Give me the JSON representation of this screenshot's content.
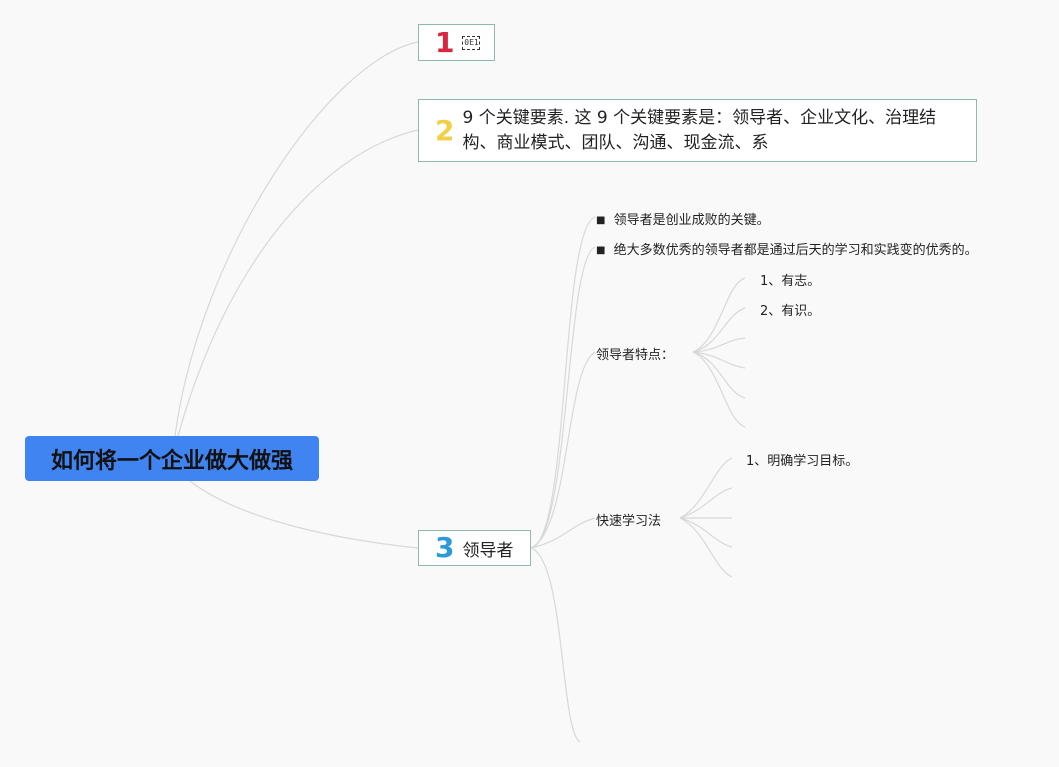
{
  "root": {
    "title": "如何将一个企业做大做强"
  },
  "topics": [
    {
      "number": "1",
      "label": ""
    },
    {
      "number": "2",
      "label": "9 个关键要素. 这 9 个关键要素是：领导者、企业文化、治理结构、商业模式、团队、沟通、现金流、系"
    },
    {
      "number": "3",
      "label": "领导者"
    }
  ],
  "leader": {
    "notes": [
      "领导者是创业成败的关键。",
      "绝大多数优秀的领导者都是通过后天的学习和实践变的优秀的。"
    ],
    "traits": {
      "label": "领导者特点：",
      "items": [
        "1、有志。",
        "2、有识。"
      ]
    },
    "fast_learning": {
      "label": "快速学习法",
      "items": [
        "1、明确学习目标。"
      ]
    }
  },
  "colors": {
    "root_bg": "#3f84f0",
    "topic_border": "#8fb8ae",
    "badge1": "#d7263d",
    "badge2": "#f2cf45",
    "badge3": "#2b9ad8"
  }
}
